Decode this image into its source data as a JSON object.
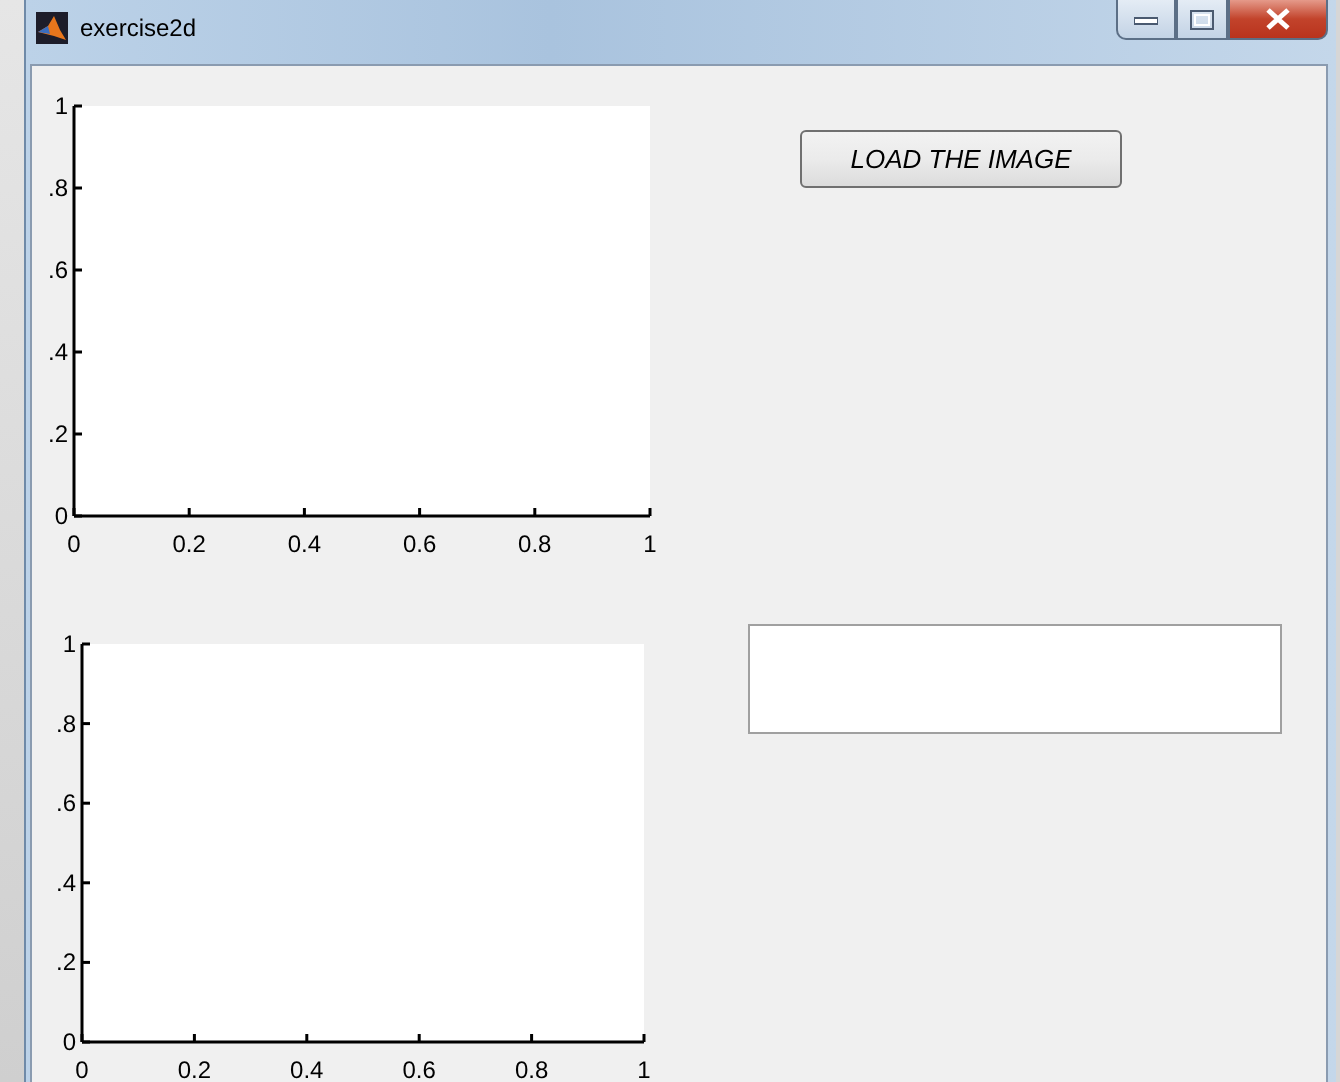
{
  "window": {
    "title": "exercise2d"
  },
  "axes": [
    {
      "chart_data": {
        "type": "line",
        "xlim": [
          0,
          1
        ],
        "ylim": [
          0,
          1
        ],
        "xticks": [
          0,
          0.2,
          0.4,
          0.6,
          0.8,
          1
        ],
        "yticks": [
          {
            "value": 0,
            "label": "0"
          },
          {
            "value": 0.2,
            "label": ".2"
          },
          {
            "value": 0.4,
            "label": ".4"
          },
          {
            "value": 0.6,
            "label": ".6"
          },
          {
            "value": 0.8,
            "label": ".8"
          },
          {
            "value": 1,
            "label": "1"
          }
        ]
      }
    },
    {
      "chart_data": {
        "type": "line",
        "xlim": [
          0,
          1
        ],
        "ylim": [
          0,
          1
        ],
        "xticks": [
          0,
          0.2,
          0.4,
          0.6,
          0.8,
          1
        ],
        "yticks": [
          {
            "value": 0,
            "label": "0"
          },
          {
            "value": 0.2,
            "label": ".2"
          },
          {
            "value": 0.4,
            "label": ".4"
          },
          {
            "value": 0.6,
            "label": ".6"
          },
          {
            "value": 0.8,
            "label": ".8"
          },
          {
            "value": 1,
            "label": "1"
          }
        ]
      }
    }
  ],
  "load_button": {
    "label": "LOAD THE IMAGE"
  }
}
